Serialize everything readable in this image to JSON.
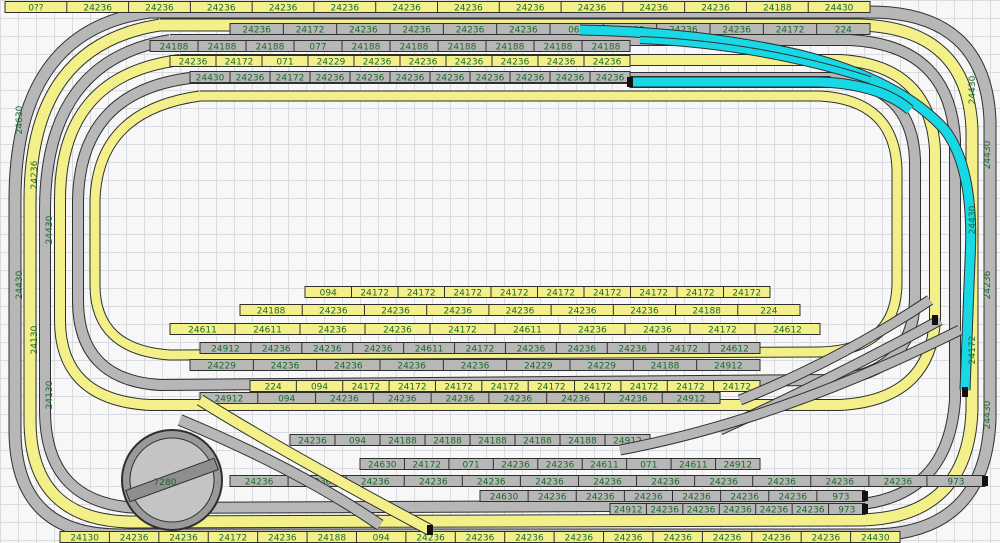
{
  "layout": {
    "labels": {
      "top_row": [
        "0??",
        "24236",
        "24236",
        "24236",
        "24236",
        "24236",
        "24236",
        "24236",
        "24236",
        "24236",
        "24236",
        "24236",
        "24188",
        "24430"
      ],
      "row2": [
        "24236",
        "24172",
        "24236",
        "24236",
        "24236",
        "24236",
        "064",
        "24188",
        "24236",
        "24236",
        "24172",
        "224"
      ],
      "row3": [
        "24188",
        "24188",
        "24188",
        "077",
        "24188",
        "24188",
        "24188",
        "24188",
        "24188",
        "24188"
      ],
      "row4": [
        "24236",
        "24172",
        "071",
        "24229",
        "24236",
        "24236",
        "24236",
        "24236",
        "24236",
        "24236"
      ],
      "row5": [
        "24430",
        "24236",
        "24172",
        "24236",
        "24236",
        "24236",
        "24236",
        "24236",
        "24236",
        "24236",
        "24236"
      ],
      "inner_top": [
        "094",
        "24172",
        "24172",
        "24172",
        "24172",
        "24172",
        "24172",
        "24172",
        "24172",
        "24172"
      ],
      "inner_row2": [
        "24188",
        "24236",
        "24236",
        "24236",
        "24236",
        "24236",
        "24236",
        "24188",
        "224"
      ],
      "inner_row3": [
        "24611",
        "24611",
        "24236",
        "24236",
        "24172",
        "24611",
        "24236",
        "24236",
        "24172",
        "24612"
      ],
      "inner_row4": [
        "24912",
        "24236",
        "24236",
        "24236",
        "24611",
        "24172",
        "24236",
        "24236",
        "24236",
        "24172",
        "24612"
      ],
      "inner_row5": [
        "24229",
        "24236",
        "24236",
        "24236",
        "24236",
        "24229",
        "24229",
        "24188",
        "24912"
      ],
      "inner_row6": [
        "224",
        "094",
        "24172",
        "24172",
        "24172",
        "24172",
        "24172",
        "24172",
        "24172",
        "24172",
        "24172"
      ],
      "lower_row1": [
        "24912",
        "094",
        "24236",
        "24236",
        "24236",
        "24236",
        "24236",
        "24236",
        "24912"
      ],
      "lower_row2": [
        "24236",
        "094",
        "24188",
        "24188",
        "24188",
        "24188",
        "24188",
        "24912"
      ],
      "lower_row3": [
        "24630",
        "24172",
        "071",
        "24236",
        "24236",
        "24611",
        "071",
        "24611",
        "24912"
      ],
      "lower_row4": [
        "24236",
        "24236",
        "24236",
        "24236",
        "24236",
        "24236",
        "24236",
        "24236",
        "24236",
        "24236",
        "24236",
        "24236",
        "973"
      ],
      "lower_row5": [
        "24630",
        "24236",
        "24236",
        "24236",
        "24236",
        "24236",
        "24236",
        "973"
      ],
      "lower_row6": [
        "24912",
        "24236",
        "24236",
        "24236",
        "24236",
        "24236",
        "973"
      ],
      "bottom_row": [
        "24130",
        "24236",
        "24236",
        "24172",
        "24236",
        "24188",
        "094",
        "24236",
        "24236",
        "24236",
        "24236",
        "24236",
        "24236",
        "24236",
        "24236",
        "24236",
        "24430"
      ],
      "turntable": "7280",
      "left_vertical": [
        "24630",
        "24236",
        "24430",
        "24430",
        "24130",
        "24130"
      ],
      "right_vertical": [
        "24430",
        "24430",
        "24430",
        "24236",
        "24172",
        "24430"
      ]
    }
  },
  "colors": {
    "grey_track": "#b7b7b7",
    "yellow_track": "#f3f08a",
    "cyan_track": "#19d8e6",
    "outline": "#2f2f2f",
    "label": "#1a6b2a",
    "buffer": "#111111",
    "turntable": "#8e8e8e"
  }
}
